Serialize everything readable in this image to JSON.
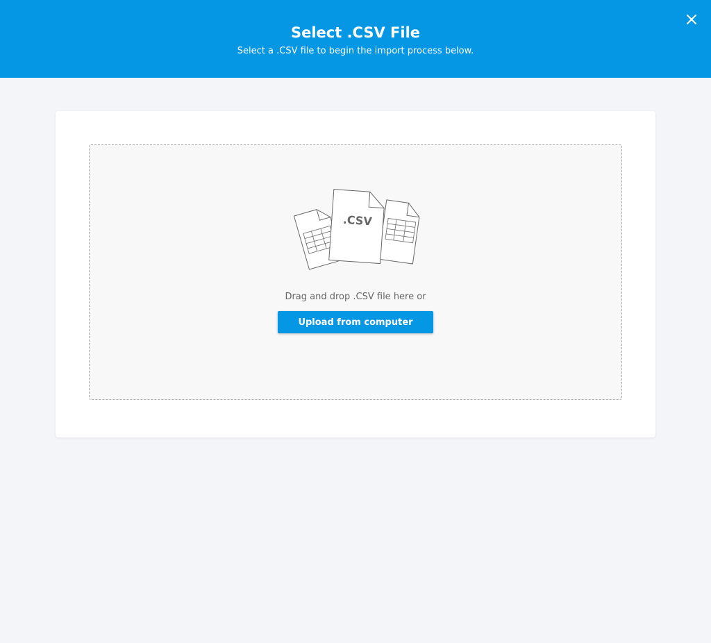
{
  "header": {
    "title": "Select .CSV File",
    "subtitle": "Select a .CSV file to begin the import process below.",
    "close_icon": "close-icon"
  },
  "dropzone": {
    "illustration_label": ".CSV",
    "instruction": "Drag and drop .CSV file here or",
    "upload_button_label": "Upload from computer"
  },
  "colors": {
    "primary": "#0597e3",
    "page_background": "#f3f5f8",
    "card_background": "#ffffff",
    "dropzone_background": "#f8f8f8",
    "muted_text": "#666666"
  }
}
